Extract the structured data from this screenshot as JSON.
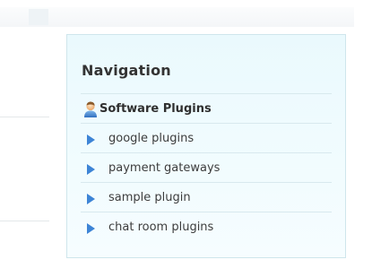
{
  "navigation": {
    "title": "Navigation",
    "section": {
      "label": "Software Plugins",
      "icon": "user-icon"
    },
    "items": [
      {
        "label": "google plugins",
        "icon": "arrow-right-icon"
      },
      {
        "label": "payment gateways",
        "icon": "arrow-right-icon"
      },
      {
        "label": "sample plugin",
        "icon": "arrow-right-icon"
      },
      {
        "label": "chat room plugins",
        "icon": "arrow-right-icon"
      }
    ]
  },
  "colors": {
    "panel_background": "#eaf9fd",
    "panel_border": "#cfe6ec",
    "arrow": "#3d84d6",
    "text": "#333333"
  }
}
